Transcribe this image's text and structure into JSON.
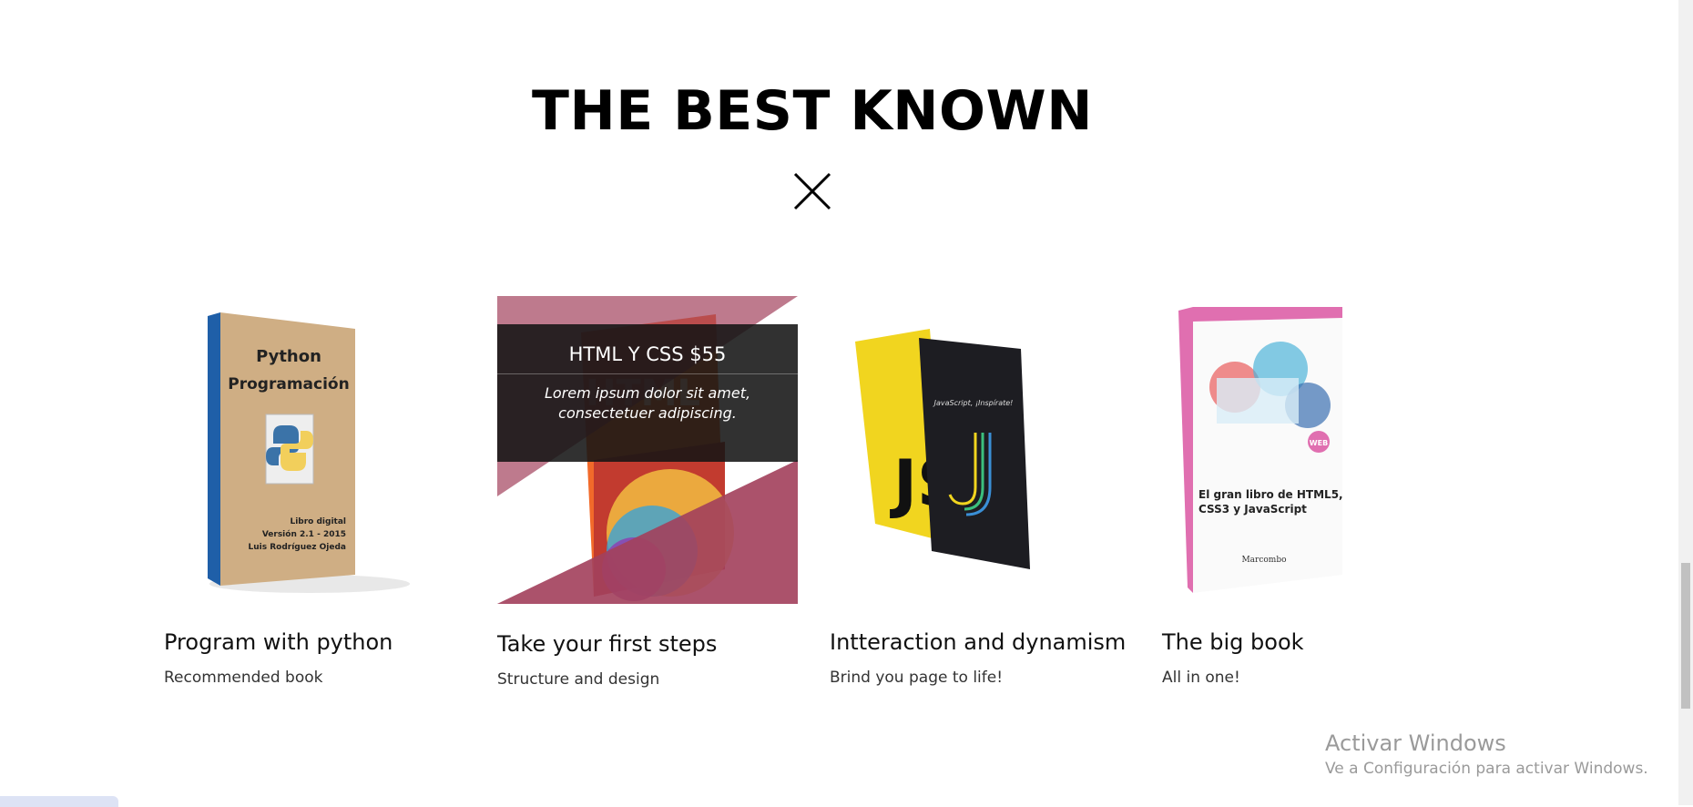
{
  "section": {
    "title": "THE BEST KNOWN",
    "close_icon": "close-icon"
  },
  "books": [
    {
      "title": "Program with python",
      "subtitle": "Recommended book",
      "cover_text": [
        "Python",
        "Programación",
        "Libro digital",
        "Versión 2.1 - 2015",
        "Luis Rodríguez Ojeda"
      ]
    },
    {
      "title": "Take your first steps",
      "subtitle": "Structure and design",
      "overlay": {
        "title": "HTML Y CSS $55",
        "description": "Lorem ipsum dolor sit amet, consectetuer adipiscing."
      }
    },
    {
      "title": "Intteraction and dynamism",
      "subtitle": "Brind you page to life!",
      "cover_text": [
        "JavaScript, ¡Inspírate!"
      ]
    },
    {
      "title": "The big book",
      "subtitle": "All in one!",
      "cover_text": [
        "El gran libro de HTML5,",
        "CSS3 y JavaScript",
        "WEB",
        "Marcombo"
      ]
    }
  ],
  "colors": {
    "overlay_pink": "#a3425c",
    "overlay_dark": "#141414"
  },
  "windows_watermark": {
    "title": "Activar Windows",
    "subtitle": "Ve a Configuración para activar Windows."
  }
}
